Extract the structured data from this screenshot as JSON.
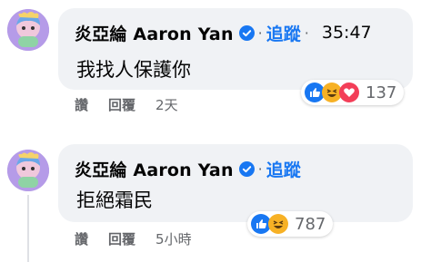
{
  "comments": [
    {
      "author": "炎亞綸 Aaron Yan",
      "follow_label": "追蹤",
      "separator": "·",
      "time": "35:47",
      "text": "我找人保護你",
      "reaction_count": "137",
      "reactions": [
        "like",
        "haha",
        "love"
      ],
      "actions": {
        "like": "讚",
        "reply": "回覆",
        "timestamp": "2天"
      }
    },
    {
      "author": "炎亞綸 Aaron Yan",
      "follow_label": "追蹤",
      "text": "拒絕霜民",
      "reaction_count": "787",
      "reactions": [
        "like",
        "haha"
      ],
      "actions": {
        "like": "讚",
        "reply": "回覆",
        "timestamp": "5小時"
      }
    }
  ],
  "colors": {
    "bubble": "#f0f2f5",
    "follow": "#1877f2",
    "verified": "#1877f2",
    "like": "#1877f2",
    "haha": "#f7b125",
    "love": "#f33e58",
    "meta": "#65676b"
  }
}
